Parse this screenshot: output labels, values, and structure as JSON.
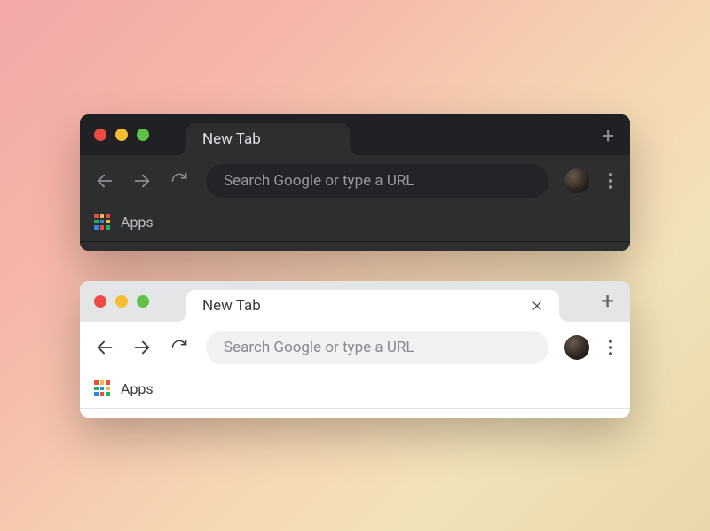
{
  "variants": {
    "dark": {
      "tab_title": "New Tab",
      "omnibox_placeholder": "Search Google or type a URL",
      "bookmark_label": "Apps"
    },
    "light": {
      "tab_title": "New Tab",
      "omnibox_placeholder": "Search Google or type a URL",
      "bookmark_label": "Apps"
    }
  },
  "traffic_lights": [
    "close",
    "minimize",
    "zoom"
  ],
  "colors": {
    "dark_bg": "#2d2e30",
    "dark_strip": "#202124",
    "light_bg": "#ffffff",
    "light_strip": "#e4e5e7",
    "traffic_red": "#ed4b42",
    "traffic_yellow": "#f5bd32",
    "traffic_green": "#5fc246"
  }
}
